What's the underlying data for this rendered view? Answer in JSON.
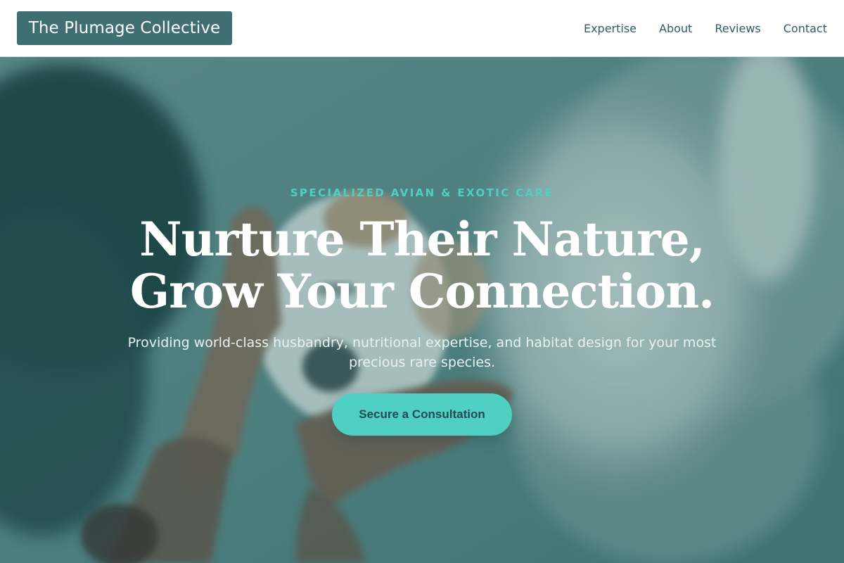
{
  "brand": {
    "name": "The Plumage Collective"
  },
  "nav": {
    "links": [
      {
        "label": "Expertise"
      },
      {
        "label": "About"
      },
      {
        "label": "Reviews"
      },
      {
        "label": "Contact"
      }
    ]
  },
  "hero": {
    "eyebrow": "SPECIALIZED AVIAN & EXOTIC CARE",
    "title_line1": "Nurture Their Nature,",
    "title_line2": "Grow Your Connection.",
    "subtitle": "Providing world-class husbandry, nutritional expertise, and habitat design for your most precious rare species.",
    "cta_label": "Secure a Consultation",
    "background_image": "photo-hands-holding-white-dog"
  },
  "colors": {
    "brand": "#3f6e73",
    "accent": "#4fd0c3",
    "nav_text": "#2f5b63",
    "cta_text": "#234a52"
  }
}
